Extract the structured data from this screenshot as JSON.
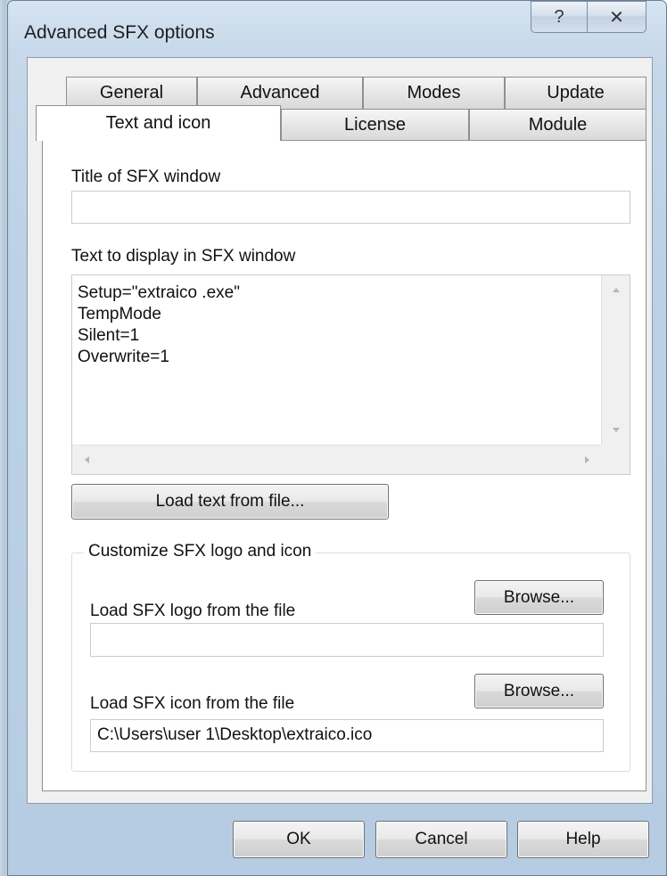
{
  "window": {
    "title": "Advanced SFX options",
    "help_glyph": "?",
    "close_glyph": "✕"
  },
  "tabs": {
    "row_back": [
      {
        "label": "General"
      },
      {
        "label": "Advanced"
      },
      {
        "label": "Modes"
      },
      {
        "label": "Update"
      }
    ],
    "row_front": [
      {
        "label": "Text and icon",
        "selected": true
      },
      {
        "label": "License"
      },
      {
        "label": "Module"
      }
    ]
  },
  "panel": {
    "title_label": "Title of SFX window",
    "title_value": "",
    "text_label": "Text to display in SFX window",
    "text_lines": [
      "Setup=\"extraico .exe\"",
      "TempMode",
      "Silent=1",
      "Overwrite=1"
    ],
    "load_text_button": "Load text from file...",
    "group": {
      "title": "Customize SFX logo and icon",
      "logo_label": "Load SFX logo from the file",
      "logo_value": "",
      "logo_browse": "Browse...",
      "icon_label": "Load SFX icon from the file",
      "icon_value": "C:\\Users\\user 1\\Desktop\\extraico.ico",
      "icon_browse": "Browse..."
    }
  },
  "footer": {
    "ok": "OK",
    "cancel": "Cancel",
    "help": "Help"
  },
  "colors": {
    "frame": "#b6cce2",
    "client": "#f0f0f0",
    "panel": "#ffffff"
  }
}
